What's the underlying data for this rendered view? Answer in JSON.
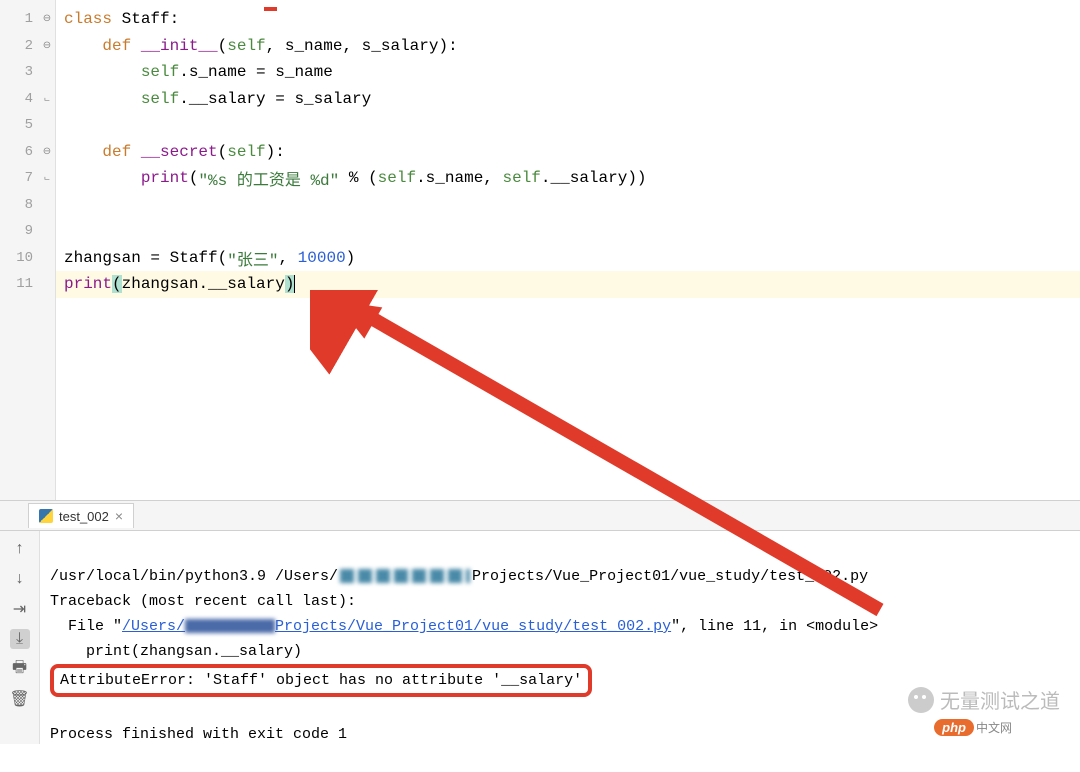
{
  "editor": {
    "lines": [
      {
        "n": "1",
        "fold": "−",
        "tokens": [
          {
            "t": "class ",
            "c": "kw"
          },
          {
            "t": "Staff:",
            "c": "cls"
          }
        ]
      },
      {
        "n": "2",
        "fold": "−",
        "tokens": [
          {
            "t": "    ",
            "c": ""
          },
          {
            "t": "def ",
            "c": "kw"
          },
          {
            "t": "__init__",
            "c": "fn"
          },
          {
            "t": "(",
            "c": ""
          },
          {
            "t": "self",
            "c": "nm"
          },
          {
            "t": ", s_name, s_salary):",
            "c": ""
          }
        ]
      },
      {
        "n": "3",
        "fold": "",
        "tokens": [
          {
            "t": "        ",
            "c": ""
          },
          {
            "t": "self",
            "c": "nm"
          },
          {
            "t": ".s_name = s_name",
            "c": ""
          }
        ]
      },
      {
        "n": "4",
        "fold": "└",
        "tokens": [
          {
            "t": "        ",
            "c": ""
          },
          {
            "t": "self",
            "c": "nm"
          },
          {
            "t": ".__salary = s_salary",
            "c": ""
          }
        ]
      },
      {
        "n": "5",
        "fold": "",
        "tokens": []
      },
      {
        "n": "6",
        "fold": "−",
        "tokens": [
          {
            "t": "    ",
            "c": ""
          },
          {
            "t": "def ",
            "c": "kw"
          },
          {
            "t": "__secret",
            "c": "fn"
          },
          {
            "t": "(",
            "c": ""
          },
          {
            "t": "self",
            "c": "nm"
          },
          {
            "t": "):",
            "c": ""
          }
        ]
      },
      {
        "n": "7",
        "fold": "└",
        "tokens": [
          {
            "t": "        ",
            "c": ""
          },
          {
            "t": "print",
            "c": "fn"
          },
          {
            "t": "(",
            "c": ""
          },
          {
            "t": "\"%s 的工资是 %d\"",
            "c": "str"
          },
          {
            "t": " % (",
            "c": ""
          },
          {
            "t": "self",
            "c": "nm"
          },
          {
            "t": ".s_name, ",
            "c": ""
          },
          {
            "t": "self",
            "c": "nm"
          },
          {
            "t": ".__salary))",
            "c": ""
          }
        ]
      },
      {
        "n": "8",
        "fold": "",
        "tokens": []
      },
      {
        "n": "9",
        "fold": "",
        "tokens": []
      },
      {
        "n": "10",
        "fold": "",
        "tokens": [
          {
            "t": "zhangsan = Staff(",
            "c": ""
          },
          {
            "t": "\"张三\"",
            "c": "str"
          },
          {
            "t": ", ",
            "c": ""
          },
          {
            "t": "10000",
            "c": "num"
          },
          {
            "t": ")",
            "c": ""
          }
        ]
      },
      {
        "n": "11",
        "fold": "",
        "hl": true,
        "tokens": [
          {
            "t": "print",
            "c": "fn"
          },
          {
            "t": "(",
            "c": "hl-paren"
          },
          {
            "t": "zhangsan.__salary",
            "c": ""
          },
          {
            "t": ")",
            "c": "hl-paren"
          }
        ]
      }
    ]
  },
  "console": {
    "tab_label": "test_002",
    "output": {
      "cmd_prefix": "/usr/local/bin/python3.9 /Users/",
      "cmd_suffix": "Projects/Vue_Project01/vue_study/test_002.py",
      "traceback": "Traceback (most recent call last):",
      "file_prefix": "  File \"",
      "file_link1": "/Users/",
      "file_link2": "Projects/Vue_Project01/vue_study/test_002.py",
      "file_suffix": "\", line 11, in <module>",
      "err_line": "    print(zhangsan.__salary)",
      "attr_err": "AttributeError: 'Staff' object has no attribute '__salary'",
      "exit": "Process finished with exit code 1"
    }
  },
  "watermark": {
    "text": "无量测试之道",
    "php": "php",
    "cn": "中文网"
  }
}
